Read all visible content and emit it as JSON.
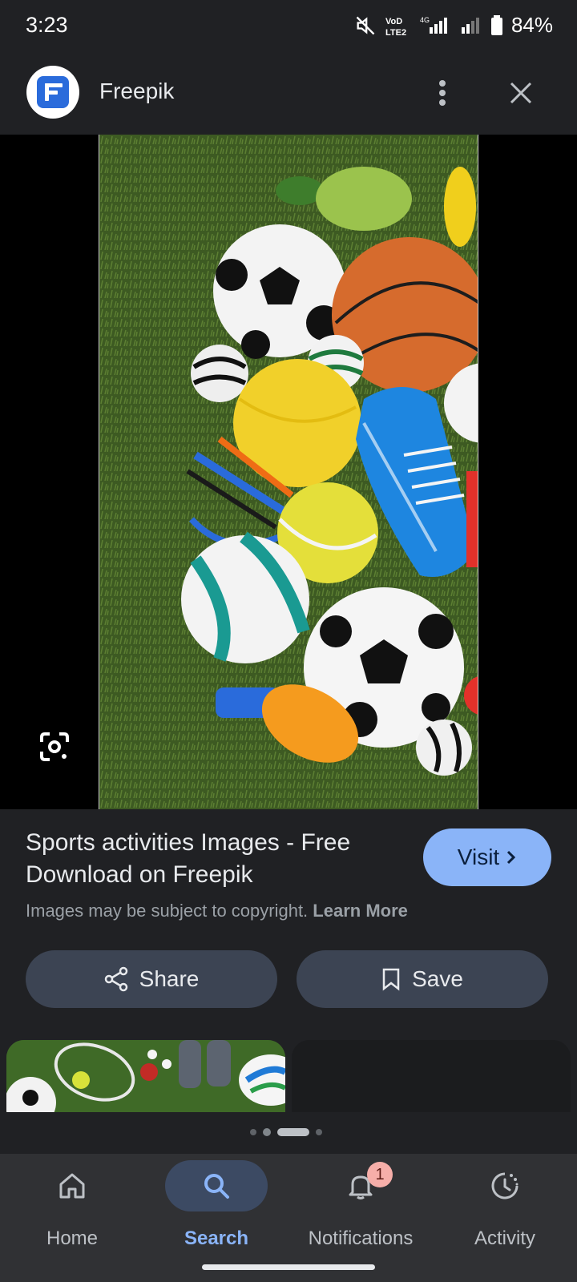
{
  "status_bar": {
    "time": "3:23",
    "network_label": "VoLTE 4G",
    "battery": "84%"
  },
  "header": {
    "site_name": "Freepik"
  },
  "result": {
    "title": "Sports activities Images - Free Download on Freepik",
    "visit_label": "Visit",
    "copyright_text": "Images may be subject to copyright.",
    "learn_more": "Learn More",
    "share_label": "Share",
    "save_label": "Save"
  },
  "pagination": {
    "total": 4,
    "active_index": 2
  },
  "bottom_nav": {
    "items": [
      {
        "label": "Home",
        "icon": "home-icon"
      },
      {
        "label": "Search",
        "icon": "search-icon",
        "active": true
      },
      {
        "label": "Notifications",
        "icon": "bell-icon",
        "badge": "1"
      },
      {
        "label": "Activity",
        "icon": "history-icon"
      }
    ]
  },
  "colors": {
    "background": "#202124",
    "accent": "#8ab4f8",
    "button_bg": "#3c4453",
    "badge": "#f6aea9"
  }
}
